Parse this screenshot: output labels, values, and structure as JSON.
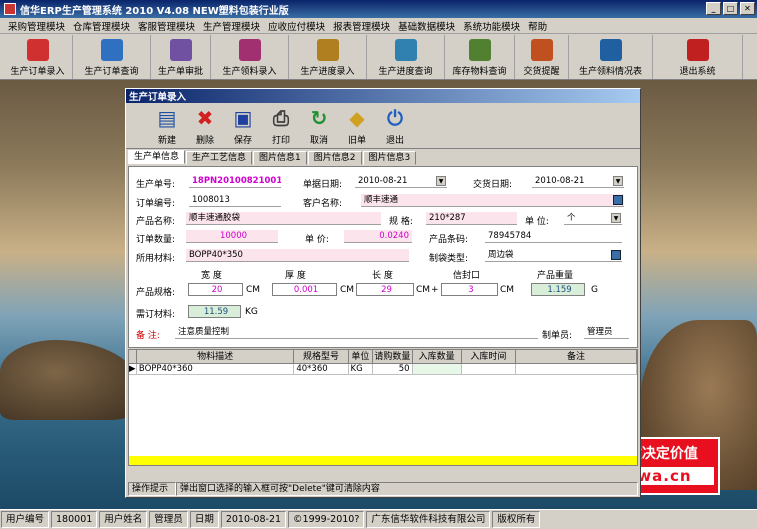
{
  "app": {
    "title": "信华ERP生产管理系统   2010 V4.08 NEW塑料包装行业版",
    "btn_min": "_",
    "btn_max": "□",
    "btn_close": "✕"
  },
  "menu": [
    "采购管理模块",
    "仓库管理模块",
    "客服管理模块",
    "生产管理模块",
    "应收应付模块",
    "报表管理模块",
    "基础数据模块",
    "系统功能模块",
    "帮助"
  ],
  "toolbar": [
    {
      "label": "生产订单录入",
      "icon": "pdf-doc-icon",
      "color": "#d03030"
    },
    {
      "label": "生产订单查询",
      "icon": "query-icon",
      "color": "#3070c0"
    },
    {
      "label": "生产单审批",
      "icon": "approve-icon",
      "color": "#7050a0"
    },
    {
      "label": "生产领料录入",
      "icon": "material-icon",
      "color": "#a03070"
    },
    {
      "label": "生产进度录入",
      "icon": "progress-icon",
      "color": "#b08020"
    },
    {
      "label": "生产进度查询",
      "icon": "progress-query-icon",
      "color": "#3080b0"
    },
    {
      "label": "库存物料查询",
      "icon": "stock-icon",
      "color": "#508030"
    },
    {
      "label": "交货提醒",
      "icon": "delivery-icon",
      "color": "#c05020"
    },
    {
      "label": "生产领料情况表",
      "icon": "report-icon",
      "color": "#2060a0"
    },
    {
      "label": "退出系统",
      "icon": "exit-icon",
      "color": "#c02020"
    }
  ],
  "window": {
    "title": "生产订单录入"
  },
  "wtoolbar": [
    {
      "label": "新建",
      "icon": "new-icon",
      "glyph": "▤",
      "color": "#2050a0"
    },
    {
      "label": "删除",
      "icon": "delete-icon",
      "glyph": "✖",
      "color": "#d02020"
    },
    {
      "label": "保存",
      "icon": "save-icon",
      "glyph": "▣",
      "color": "#2040a0"
    },
    {
      "label": "打印",
      "icon": "print-icon",
      "glyph": "⎙",
      "color": "#404040"
    },
    {
      "label": "取消",
      "icon": "cancel-icon",
      "glyph": "↻",
      "color": "#209030"
    },
    {
      "label": "旧单",
      "icon": "old-order-icon",
      "glyph": "◆",
      "color": "#d0a020"
    },
    {
      "label": "退出",
      "icon": "exit-icon",
      "glyph": "⏻",
      "color": "#2060c0"
    }
  ],
  "tabs": [
    "生产单信息",
    "生产工艺信息",
    "图片信息1",
    "图片信息2",
    "图片信息3"
  ],
  "form": {
    "order_no_label": "生产单号:",
    "order_no": "18PN20100821001",
    "date_label": "单据日期:",
    "date": "2010-08-21",
    "delivery_label": "交货日期:",
    "delivery": "2010-08-21",
    "ord_num_label": "订单编号:",
    "ord_num": "1008013",
    "customer_label": "客户名称:",
    "customer": "顺丰速通",
    "product_label": "产品名称:",
    "product": "顺丰速通胶袋",
    "spec_label": "规 格:",
    "spec": "210*287",
    "unit_label": "单 位:",
    "unit": "个",
    "qty_label": "订单数量:",
    "qty": "10000",
    "price_label": "单 价:",
    "price": "0.0240",
    "barcode_label": "产品条码:",
    "barcode": "78945784",
    "material_label": "所用材料:",
    "material": "BOPP40*350",
    "make_label": "制袋类型:",
    "make": "周边袋",
    "width_h": "宽 度",
    "thick_h": "厚 度",
    "length_h": "长 度",
    "seal_h": "信封口",
    "weight_h": "产品重量",
    "spec2_label": "产品规格:",
    "width": "20",
    "thick": "0.001",
    "length": "29",
    "seal": "3",
    "weight": "1.159",
    "unit_cm": "CM",
    "unit_g": "G",
    "plus": "+",
    "need_label": "需订材料:",
    "need": "11.59",
    "unit_kg": "KG",
    "note_label": "备 注:",
    "note": "注意质量控制",
    "maker_label": "制单员:",
    "maker": "管理员"
  },
  "grid": {
    "headers": [
      "物料描述",
      "规格型号",
      "单位",
      "请购数量",
      "入库数量",
      "入库时间",
      "备注"
    ],
    "rows": [
      [
        "BOPP40*360",
        "40*360",
        "KG",
        "50",
        "",
        "",
        ""
      ]
    ],
    "pointer": "▶"
  },
  "hint": {
    "label": "操作提示",
    "text": "弹出窗口选择的输入框可按\"Delete\"键可清除内容"
  },
  "status": [
    {
      "label": "用户编号",
      "value": "180001"
    },
    {
      "label": "用户姓名",
      "value": "管理员"
    },
    {
      "label": "日期",
      "value": "2010-08-21"
    },
    {
      "label": "",
      "value": "©1999-2010?"
    },
    {
      "label": "",
      "value": "广东信华软件科技有限公司"
    },
    {
      "label": "",
      "value": "版权所有"
    }
  ],
  "promo": {
    "line1": "信华软件-品质决定价值",
    "line2": "www.xinwa.cn"
  }
}
